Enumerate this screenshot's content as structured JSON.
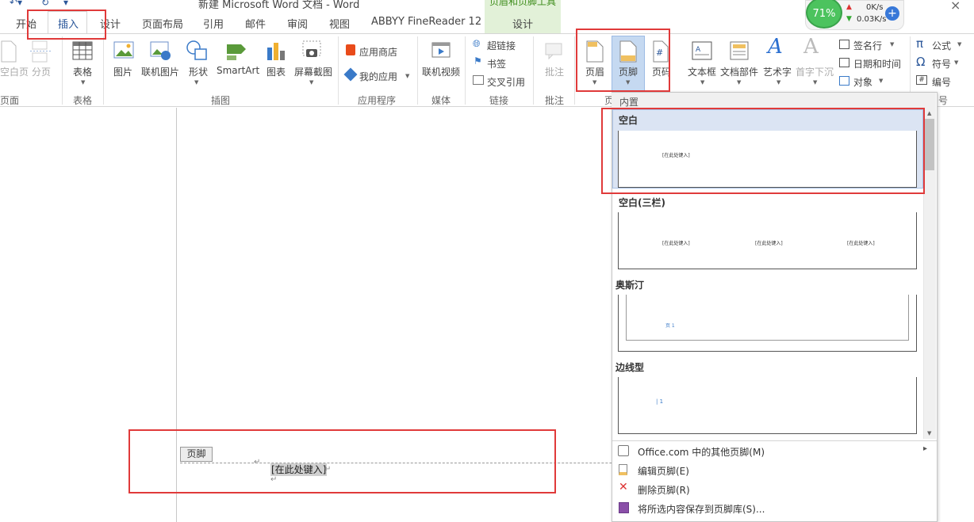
{
  "window": {
    "title": "新建 Microsoft Word 文档 - Word",
    "context_group": "页眉和页脚工具",
    "close_glyph": "×"
  },
  "tabs": [
    "开始",
    "插入",
    "设计",
    "页面布局",
    "引用",
    "邮件",
    "审阅",
    "视图",
    "ABBYY FineReader 12"
  ],
  "context_tab": "设计",
  "ribbon": {
    "pages_group": {
      "label": "页面",
      "blank_page": "空白页",
      "page_break": "分页"
    },
    "table_group": {
      "label": "表格",
      "table": "表格"
    },
    "illustrations_group": {
      "label": "插图",
      "picture": "图片",
      "online_picture": "联机图片",
      "shapes": "形状",
      "smartart": "SmartArt",
      "chart": "图表",
      "screenshot": "屏幕截图"
    },
    "apps_group": {
      "label": "应用程序",
      "store": "应用商店",
      "my_apps": "我的应用"
    },
    "media_group": {
      "label": "媒体",
      "online_video": "联机视频"
    },
    "links_group": {
      "label": "链接",
      "hyperlink": "超链接",
      "bookmark": "书签",
      "cross_ref": "交叉引用"
    },
    "comments_group": {
      "label": "批注",
      "comment": "批注"
    },
    "hf_group": {
      "label": "页",
      "header": "页眉",
      "footer": "页脚",
      "page_number": "页码"
    },
    "text_group": {
      "text_box": "文本框",
      "quick_parts": "文档部件",
      "wordart": "艺术字",
      "drop_cap": "首字下沉",
      "signature": "签名行",
      "datetime": "日期和时间",
      "object": "对象"
    },
    "symbols_group": {
      "label": "号",
      "equation": "公式",
      "symbol": "符号",
      "number": "编号",
      "equation_glyph": "π",
      "symbol_glyph": "Ω",
      "number_glyph": "#"
    }
  },
  "network": {
    "percent": "71%",
    "up": "0K/s",
    "down": "0.03K/s",
    "plus": "+"
  },
  "document": {
    "footer_tag": "页脚",
    "placeholder": "[在此处键入]",
    "para_mark": "↵"
  },
  "footer_gallery": {
    "section_label": "内置",
    "items": [
      {
        "name": "空白",
        "thumb_text": [
          "[在此处键入]"
        ]
      },
      {
        "name": "空白(三栏)",
        "thumb_text": [
          "[在此处键入]",
          "[在此处键入]",
          "[在此处键入]"
        ]
      },
      {
        "name": "奥斯汀",
        "thumb_text": [
          "页 1"
        ]
      },
      {
        "name": "边线型",
        "thumb_text": [
          "| 1"
        ]
      }
    ],
    "menu": [
      {
        "label": "Office.com 中的其他页脚(M)",
        "has_submenu": true,
        "submenu_glyph": "▸"
      },
      {
        "label": "编辑页脚(E)"
      },
      {
        "label": "删除页脚(R)"
      },
      {
        "label": "将所选内容保存到页脚库(S)..."
      }
    ]
  },
  "colors": {
    "accent": "#2b579a",
    "highlight_box": "#e03a3a",
    "context_tab_bg": "#e2f1d8",
    "selected_item_bg": "#dbe4f3"
  }
}
